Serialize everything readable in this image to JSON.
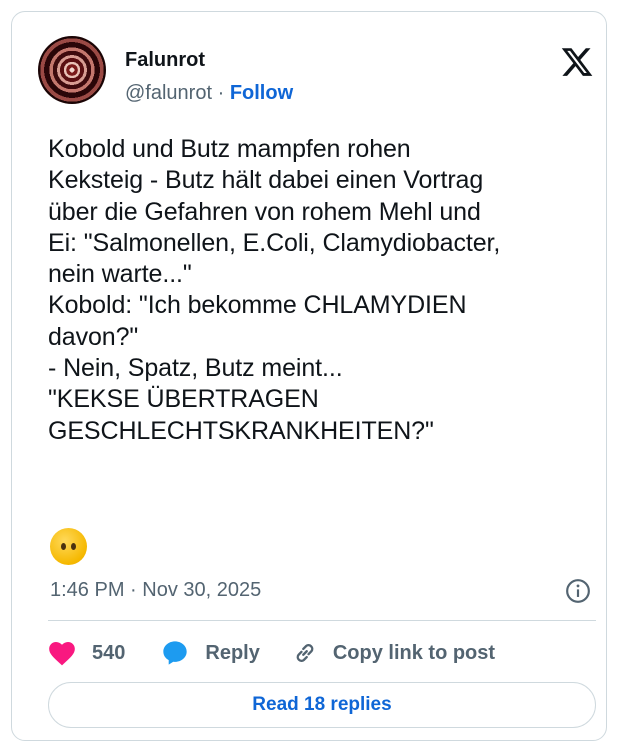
{
  "author": {
    "name": "Falunrot",
    "handle": "@falunrot",
    "separator": "·",
    "follow_label": "Follow"
  },
  "tweet": {
    "text": "Kobold und Butz mampfen rohen\nKeksteig - Butz hält dabei einen Vortrag\nüber die Gefahren von rohem Mehl und\nEi: \"Salmonellen, E.Coli, Clamydiobacter,\nnein warte...\"\nKobold: \"Ich bekomme CHLAMYDIEN\ndavon?\"\n- Nein, Spatz, Butz meint...\n\"KEKSE ÜBERTRAGEN\nGESCHLECHTSKRANKHEITEN?\"",
    "emoji": "face-without-mouth",
    "timestamp": "1:46 PM · Nov 30, 2025"
  },
  "actions": {
    "like_count": "540",
    "reply_label": "Reply",
    "copy_link_label": "Copy link to post"
  },
  "read_replies_label": "Read 18 replies",
  "colors": {
    "accent": "#0f66d6",
    "like": "#f91880",
    "reply": "#1d9bf0",
    "muted": "#536471",
    "border": "#cfd9de"
  }
}
